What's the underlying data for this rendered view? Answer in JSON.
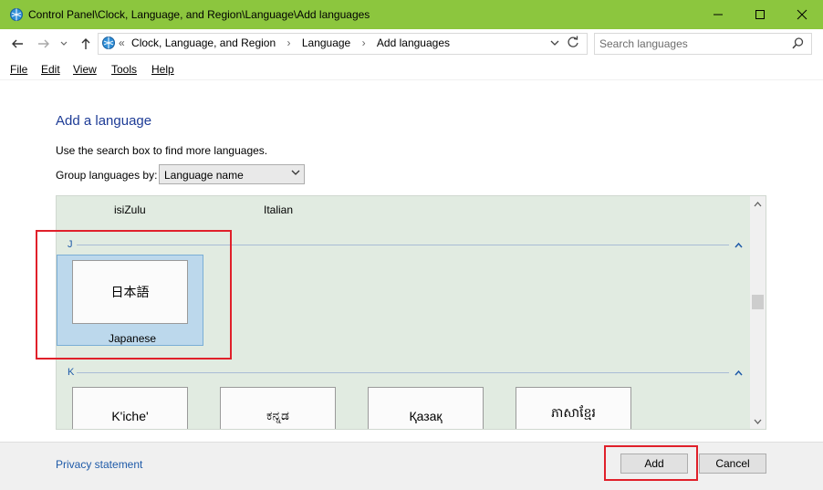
{
  "window": {
    "title": "Control Panel\\Clock, Language, and Region\\Language\\Add languages",
    "accent_color": "#8cc63e"
  },
  "address": {
    "overflow": "«",
    "crumbs": [
      "Clock, Language, and Region",
      "Language",
      "Add languages"
    ],
    "separator": "›"
  },
  "search": {
    "placeholder": "Search languages"
  },
  "menu": [
    "File",
    "Edit",
    "View",
    "Tools",
    "Help"
  ],
  "main": {
    "heading": "Add a language",
    "instruction": "Use the search box to find more languages.",
    "group_label": "Group languages by:",
    "group_value": "Language name"
  },
  "languages": {
    "top_row": [
      "isiZulu",
      "Italian"
    ],
    "groups": [
      {
        "letter": "J",
        "tiles": [
          {
            "script": "日本語",
            "name": "Japanese",
            "selected": true
          }
        ]
      },
      {
        "letter": "K",
        "tiles": [
          {
            "script": "K'iche'"
          },
          {
            "script": "ಕನ್ನಡ"
          },
          {
            "script": "Қазақ"
          },
          {
            "script": "ភាសាខ្មែរ"
          }
        ]
      }
    ]
  },
  "footer": {
    "privacy": "Privacy statement",
    "add": "Add",
    "cancel": "Cancel"
  },
  "icons": [
    "app-icon",
    "minimize-icon",
    "maximize-icon",
    "close-icon",
    "back-arrow-icon",
    "forward-arrow-icon",
    "recent-dropdown-icon",
    "up-arrow-icon",
    "dropdown-icon",
    "refresh-icon",
    "search-icon",
    "collapse-icon"
  ]
}
